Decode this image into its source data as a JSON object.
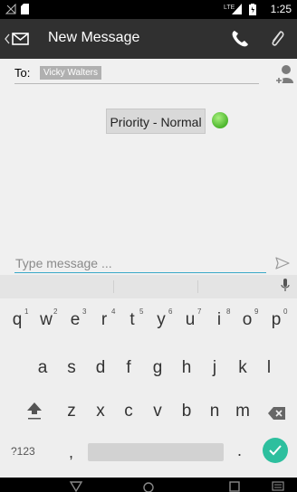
{
  "status": {
    "time": "1:25",
    "network": "LTE"
  },
  "actionbar": {
    "title": "New Message",
    "back_icon": "chevron-left-icon",
    "mail_icon": "envelope-icon",
    "call_icon": "phone-icon",
    "attach_icon": "paperclip-icon"
  },
  "to": {
    "label": "To:",
    "recipient": "Vicky Walters"
  },
  "priority": {
    "label": "Priority - Normal",
    "dot_color": "#5ac33a"
  },
  "compose": {
    "placeholder": "Type message ..."
  },
  "keyboard": {
    "row1": [
      "q",
      "w",
      "e",
      "r",
      "t",
      "y",
      "u",
      "i",
      "o",
      "p"
    ],
    "row1_nums": [
      "1",
      "2",
      "3",
      "4",
      "5",
      "6",
      "7",
      "8",
      "9",
      "0"
    ],
    "row2": [
      "a",
      "s",
      "d",
      "f",
      "g",
      "h",
      "j",
      "k",
      "l"
    ],
    "row3": [
      "z",
      "x",
      "c",
      "v",
      "b",
      "n",
      "m"
    ],
    "symbols_label": "?123",
    "comma": ",",
    "period": ".",
    "accent_color": "#2dbf9e"
  }
}
